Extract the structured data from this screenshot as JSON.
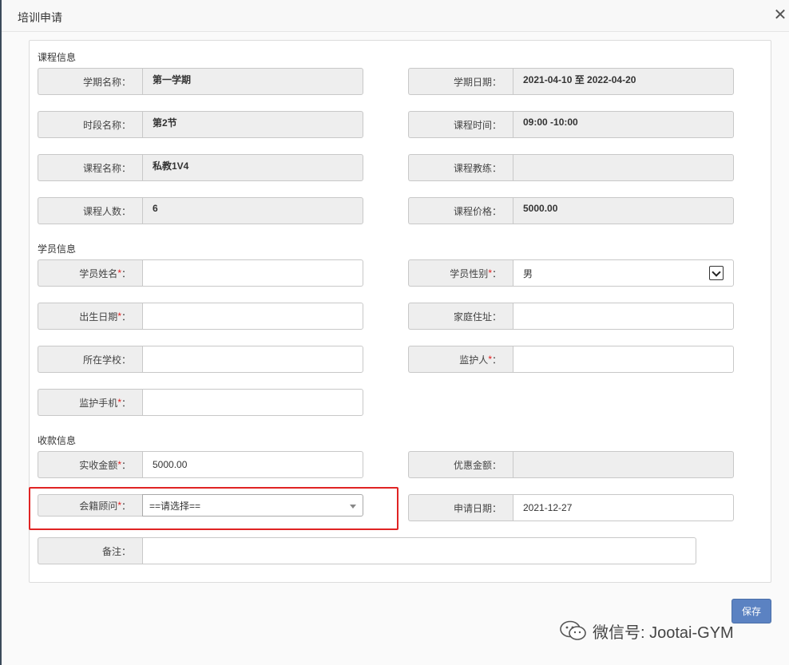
{
  "dialog": {
    "title": "培训申请",
    "close_glyph": "✕"
  },
  "sections": {
    "course": "课程信息",
    "student": "学员信息",
    "payment": "收款信息"
  },
  "course": {
    "term_name": {
      "label": "学期名称：",
      "value": "第一学期"
    },
    "term_date": {
      "label": "学期日期：",
      "value": "2021-04-10 至 2022-04-20"
    },
    "period_name": {
      "label": "时段名称：",
      "value": "第2节"
    },
    "course_time": {
      "label": "课程时间：",
      "value": "09:00 -10:00"
    },
    "course_name": {
      "label": "课程名称：",
      "value": "私教1V4"
    },
    "coach": {
      "label": "课程教练：",
      "value": ""
    },
    "headcount": {
      "label": "课程人数：",
      "value": "6"
    },
    "price": {
      "label": "课程价格：",
      "value": "5000.00"
    }
  },
  "student": {
    "name": {
      "label": "学员姓名",
      "value": ""
    },
    "gender": {
      "label": "学员性别",
      "value": "男"
    },
    "birthday": {
      "label": "出生日期",
      "value": ""
    },
    "address": {
      "label": "家庭住址：",
      "value": ""
    },
    "school": {
      "label": "所在学校：",
      "value": ""
    },
    "guardian": {
      "label": "监护人",
      "value": ""
    },
    "guardian_phone": {
      "label": "监护手机",
      "value": ""
    }
  },
  "payment": {
    "received": {
      "label": "实收金额",
      "value": "5000.00"
    },
    "discount": {
      "label": "优惠金额：",
      "value": ""
    },
    "advisor": {
      "label": "会籍顾问",
      "value": "==请选择=="
    },
    "apply_date": {
      "label": "申请日期：",
      "value": "2021-12-27"
    },
    "remark": {
      "label": "备注：",
      "value": ""
    }
  },
  "common": {
    "required_mark": "*",
    "colon": "："
  },
  "actions": {
    "save": "保存"
  },
  "watermark": {
    "text": "微信号: Jootai-GYM"
  },
  "icons": {
    "close": "close-icon",
    "select": "chevron-down-icon",
    "watermark": "wechat-icon"
  },
  "colors": {
    "accent": "#5b82c2",
    "required": "#e31b1b",
    "highlight": "#e02424"
  }
}
